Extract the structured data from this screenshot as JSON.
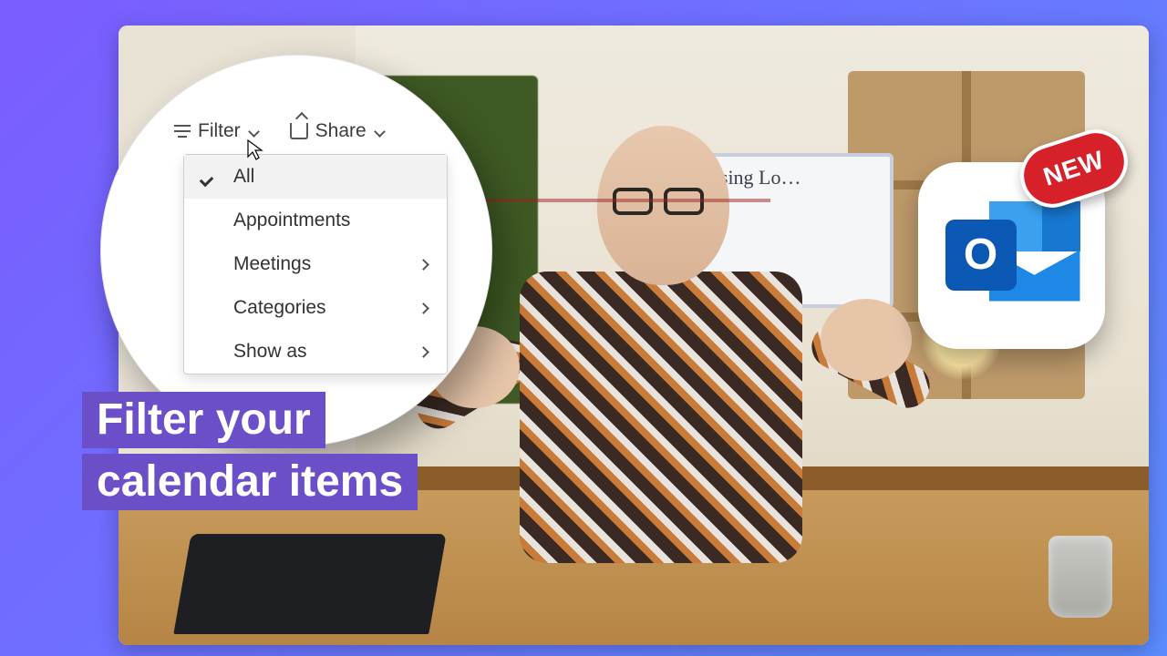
{
  "whiteboard_text": "Using Lo…",
  "toolbar": {
    "filter_label": "Filter",
    "share_label": "Share"
  },
  "filter_menu": {
    "items": [
      {
        "label": "All",
        "selected": true,
        "submenu": false
      },
      {
        "label": "Appointments",
        "selected": false,
        "submenu": false
      },
      {
        "label": "Meetings",
        "selected": false,
        "submenu": true
      },
      {
        "label": "Categories",
        "selected": false,
        "submenu": true
      },
      {
        "label": "Show as",
        "selected": false,
        "submenu": true
      }
    ]
  },
  "caption": {
    "line1": "Filter your",
    "line2": "calendar items"
  },
  "app_badge": {
    "letter": "O"
  },
  "new_badge": {
    "label": "NEW"
  },
  "colors": {
    "gradient_from": "#7b5cff",
    "gradient_to": "#5b8cff",
    "caption_bg": "#6b4fc9",
    "new_badge": "#d6202a",
    "outlook_blue": "#1e88e5"
  }
}
